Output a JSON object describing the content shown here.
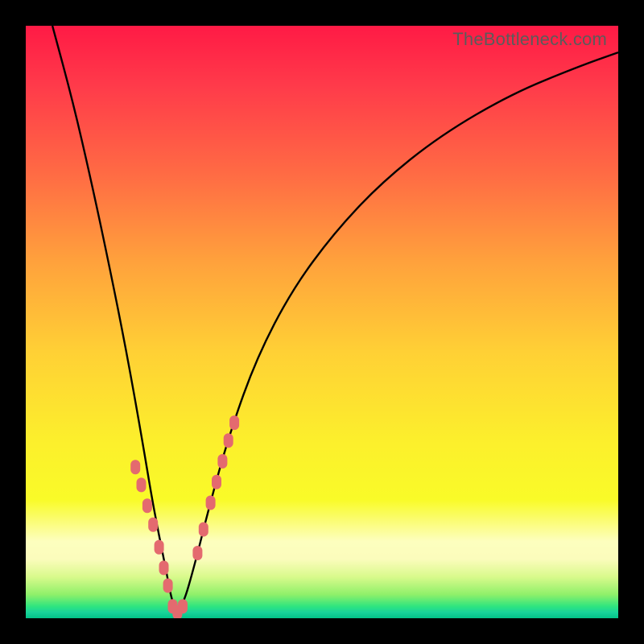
{
  "watermark": "TheBottleneck.com",
  "colors": {
    "frame": "#000000",
    "curve_stroke": "#000000",
    "marker_fill": "#e46a6f",
    "marker_stroke": "#e46a6f"
  },
  "chart_data": {
    "type": "line",
    "title": "",
    "xlabel": "",
    "ylabel": "",
    "xlim": [
      0,
      1
    ],
    "ylim": [
      0,
      1
    ],
    "note": "Axes are not labeled in the source image; coordinates are normalized to the plot area. The y value visually corresponds to bottleneck severity (top = high / red, bottom = low / green). The curve has a sharp V-shaped minimum near x≈0.25 reaching y≈0 and rises steeply on both sides.",
    "series": [
      {
        "name": "bottleneck-curve",
        "x": [
          0.045,
          0.08,
          0.11,
          0.14,
          0.17,
          0.195,
          0.215,
          0.235,
          0.25,
          0.265,
          0.285,
          0.31,
          0.345,
          0.39,
          0.45,
          0.52,
          0.6,
          0.7,
          0.82,
          0.93,
          1.0
        ],
        "y": [
          1.0,
          0.87,
          0.74,
          0.6,
          0.45,
          0.31,
          0.19,
          0.09,
          0.012,
          0.02,
          0.09,
          0.19,
          0.315,
          0.44,
          0.555,
          0.65,
          0.735,
          0.815,
          0.885,
          0.93,
          0.955
        ]
      }
    ],
    "markers": {
      "name": "highlighted-points",
      "note": "Pink rounded markers clustered near the minimum on both branches of the V.",
      "x": [
        0.185,
        0.195,
        0.205,
        0.215,
        0.225,
        0.233,
        0.24,
        0.248,
        0.256,
        0.265,
        0.29,
        0.3,
        0.312,
        0.322,
        0.332,
        0.342,
        0.352
      ],
      "y": [
        0.255,
        0.225,
        0.19,
        0.158,
        0.12,
        0.085,
        0.055,
        0.02,
        0.01,
        0.02,
        0.11,
        0.15,
        0.195,
        0.23,
        0.265,
        0.3,
        0.33
      ]
    },
    "gradient_bands": [
      {
        "label": "red-high",
        "y_from": 1.0,
        "y_to": 0.55
      },
      {
        "label": "orange",
        "y_from": 0.55,
        "y_to": 0.3
      },
      {
        "label": "yellow",
        "y_from": 0.3,
        "y_to": 0.1
      },
      {
        "label": "pale-band",
        "y_from": 0.13,
        "y_to": 0.07
      },
      {
        "label": "green-low",
        "y_from": 0.07,
        "y_to": 0.0
      }
    ]
  }
}
